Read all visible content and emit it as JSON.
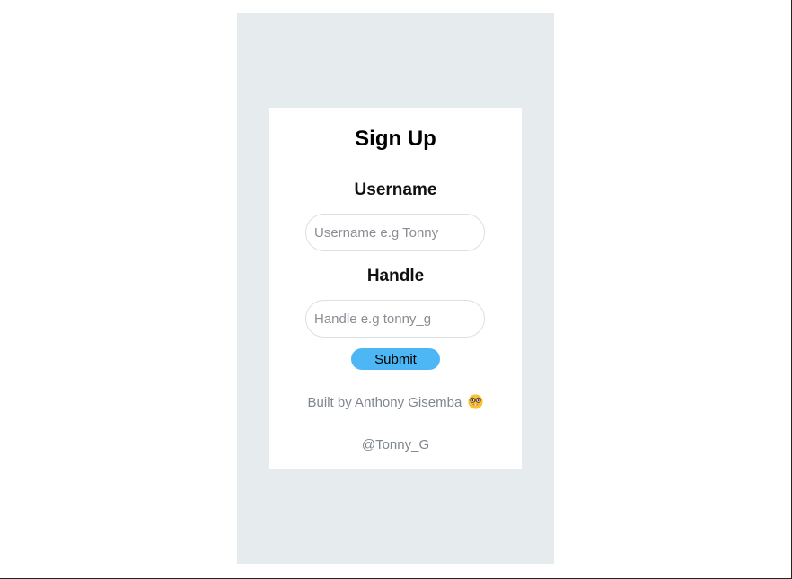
{
  "signup": {
    "title": "Sign Up",
    "username": {
      "label": "Username",
      "value": "",
      "placeholder": "Username e.g Tonny"
    },
    "handle": {
      "label": "Handle",
      "value": "",
      "placeholder": "Handle e.g tonny_g"
    },
    "submit_label": "Submit"
  },
  "footer": {
    "credit": "Built by Anthony Gisemba",
    "credit_icon": "nerd-face-emoji",
    "handle_link": "@Tonny_G"
  },
  "colors": {
    "page_background": "#ffffff",
    "panel_background": "#e6ebee",
    "card_background": "#ffffff",
    "submit_button": "#4db6f4",
    "muted_text": "#80868e"
  }
}
